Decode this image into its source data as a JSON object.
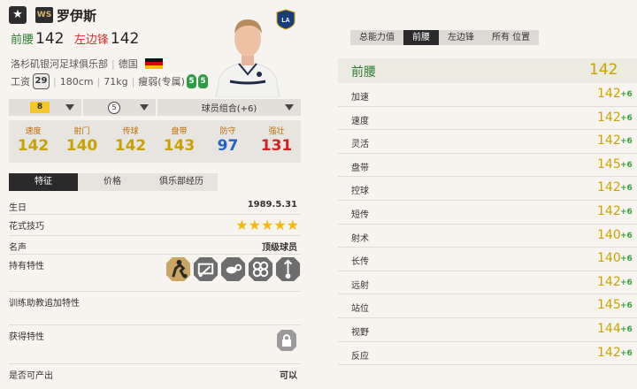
{
  "header": {
    "star_icon": "★",
    "season_badge": "WS",
    "name": "罗伊斯",
    "pos1_label": "前腰",
    "pos1_value": "142",
    "pos2_label": "左边锋",
    "pos2_value": "142"
  },
  "club": {
    "name": "洛杉矶银河足球俱乐部",
    "country": "德国",
    "logo_text": "LA"
  },
  "info": {
    "wage_label": "工资",
    "wage": "29",
    "height": "180cm",
    "weight": "71kg",
    "build": "瘦弱(专属)",
    "left_foot": "5",
    "right_foot": "5"
  },
  "selectors": {
    "level": "8",
    "upgrade": "5",
    "team_color": "球员组合(+6)"
  },
  "stats": [
    {
      "label": "速度",
      "value": "142",
      "color": "#c9a200"
    },
    {
      "label": "射门",
      "value": "140",
      "color": "#c9a200"
    },
    {
      "label": "传球",
      "value": "142",
      "color": "#c9a200"
    },
    {
      "label": "盘带",
      "value": "143",
      "color": "#c9a200"
    },
    {
      "label": "防守",
      "value": "97",
      "color": "#1e63c8"
    },
    {
      "label": "强壮",
      "value": "131",
      "color": "#d42020"
    }
  ],
  "tabs": [
    "特征",
    "价格",
    "俱乐部经历"
  ],
  "details": {
    "birthday_label": "生日",
    "birthday": "1989.5.31",
    "skill_label": "花式技巧",
    "stars": "★★★★★",
    "fame_label": "名声",
    "fame": "顶级球员",
    "traits_label": "持有特性",
    "training_label": "训练助教追加特性",
    "acquired_label": "获得特性",
    "tradeable_label": "是否可产出",
    "tradeable": "可以"
  },
  "right": {
    "tabs": [
      "总能力值",
      "前腰",
      "左边锋",
      "所有 位置"
    ],
    "position": "前腰",
    "overall": "142",
    "attributes": [
      {
        "name": "加速",
        "value": "142",
        "delta": "+6"
      },
      {
        "name": "速度",
        "value": "142",
        "delta": "+6"
      },
      {
        "name": "灵活",
        "value": "142",
        "delta": "+6"
      },
      {
        "name": "盘带",
        "value": "145",
        "delta": "+6"
      },
      {
        "name": "控球",
        "value": "142",
        "delta": "+6"
      },
      {
        "name": "短传",
        "value": "142",
        "delta": "+6"
      },
      {
        "name": "射术",
        "value": "140",
        "delta": "+6"
      },
      {
        "name": "长传",
        "value": "140",
        "delta": "+6"
      },
      {
        "name": "远射",
        "value": "142",
        "delta": "+6"
      },
      {
        "name": "站位",
        "value": "145",
        "delta": "+6"
      },
      {
        "name": "视野",
        "value": "144",
        "delta": "+6"
      },
      {
        "name": "反应",
        "value": "142",
        "delta": "+6"
      }
    ]
  }
}
